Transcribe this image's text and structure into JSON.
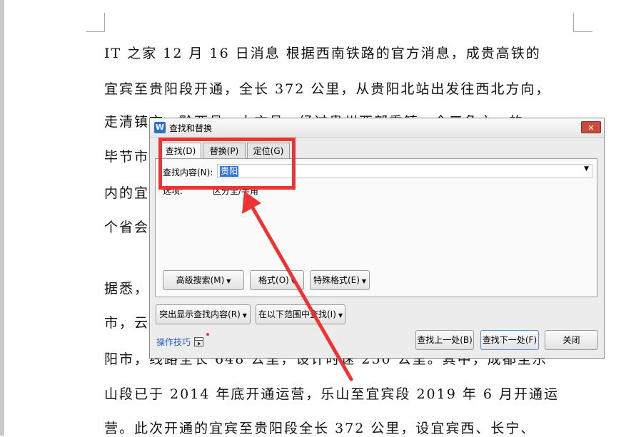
{
  "document": {
    "lines": [
      "IT 之家 12 月 16 日消息 根据西南铁路的官方消息，成贵高铁的",
      "宜宾至贵阳段开通，全长 372 公里，从贵阳北站出发往西北方向，",
      "走清镇市、黔西县、大方县，经过贵州西部重镇、全三角之一的",
      "毕节市",
      "内的宜",
      "个省会",
      "据悉，",
      "市，云",
      "阳市，线路全长 648 公里，设计时速 250 公里。其中，成都至乐",
      "山段已于 2014 年底开通运营，乐山至宜宾段 2019 年 6 月开通运",
      "营。此次开通的宜宾至贵阳段全长 372 公里，设宜宾西、长宁、"
    ]
  },
  "dialog": {
    "title": "查找和替换",
    "app_icon_glyph": "W",
    "close_glyph": "✕",
    "tabs": [
      {
        "label": "查找(D)",
        "active": true
      },
      {
        "label": "替换(P)",
        "active": false
      },
      {
        "label": "定位(G)",
        "active": false
      }
    ],
    "find_label": "查找内容(N):",
    "find_value": "贵阳",
    "options_label": "选项:",
    "options_value": "区分全/半角",
    "buttons": {
      "advanced_search": "高级搜索(M)",
      "format": "格式(O)",
      "special_format": "特殊格式(E)",
      "highlight_found": "突出显示查找内容(R)",
      "find_in_range": "在以下范围中查找(I)",
      "find_prev": "查找上一处(B)",
      "find_next": "查找下一处(F)",
      "close": "关闭"
    },
    "tips_label": "操作技巧"
  },
  "colors": {
    "annotation_red": "#ee3333",
    "selection_blue": "#3778d6",
    "link_blue": "#2b5fc9"
  }
}
